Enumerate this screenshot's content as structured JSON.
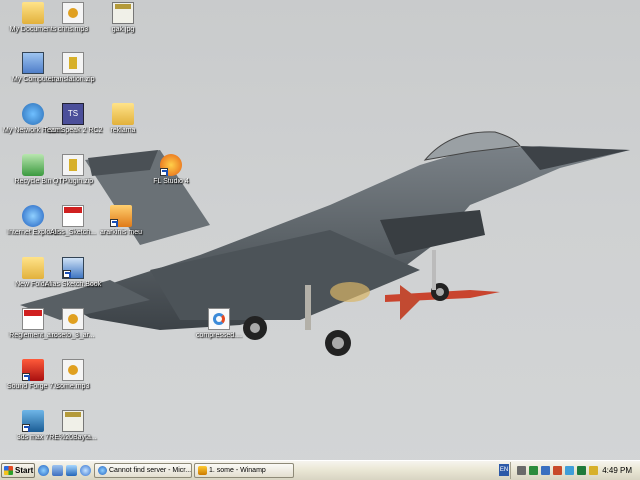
{
  "desktop": {
    "icons": [
      {
        "label": "My Documents",
        "type": "folder-docs-icon"
      },
      {
        "label": "chris.mp3",
        "type": "mp3-file-icon"
      },
      {
        "label": "gak.jpg",
        "type": "jpg-file-icon"
      },
      {
        "label": "My Computer",
        "type": "computer-icon"
      },
      {
        "label": "translation.zip",
        "type": "zip-file-icon"
      },
      {
        "label": "My Network Places",
        "type": "network-icon"
      },
      {
        "label": "TeamSpeak 2 RC2",
        "type": "teamspeak-icon"
      },
      {
        "label": "reklama",
        "type": "folder-icon"
      },
      {
        "label": "Recycle Bin",
        "type": "recycle-bin-icon"
      },
      {
        "label": "QTPlugin.zip",
        "type": "zip-file-icon"
      },
      {
        "label": "FL Studio 4",
        "type": "flstudio-icon"
      },
      {
        "label": "Internet Explorer",
        "type": "ie-icon"
      },
      {
        "label": "Aliss_Sketch...",
        "type": "pdf-file-icon"
      },
      {
        "label": "ararkinis meu",
        "type": "app-shortcut-icon"
      },
      {
        "label": "New Folder",
        "type": "folder-icon"
      },
      {
        "label": "Alias Sketch.Book",
        "type": "sketchbook-icon"
      },
      {
        "label": "Reglement_a...",
        "type": "pdf-file-icon"
      },
      {
        "label": "roseto_3_ar...",
        "type": "mp3-file-icon"
      },
      {
        "label": "compressed....",
        "type": "compressed-file-icon"
      },
      {
        "label": "Sound Forge 7.0",
        "type": "soundforge-icon"
      },
      {
        "label": "some.mp3",
        "type": "mp3-file-icon"
      },
      {
        "label": "3ds max 7",
        "type": "3dsmax-icon"
      },
      {
        "label": "RE%20Bayta...",
        "type": "jpg-file-icon"
      }
    ]
  },
  "taskbar": {
    "start_label": "Start",
    "quick_launch": [
      "ie-quicklaunch-icon",
      "desktop-quicklaunch-icon",
      "media-quicklaunch-icon",
      "ie2-quicklaunch-icon"
    ],
    "tasks": [
      {
        "label": "Cannot find server - Micr...",
        "icon": "ie-task-icon"
      },
      {
        "label": "1. some - Winamp",
        "icon": "winamp-task-icon"
      }
    ],
    "tray": {
      "lang": "EN",
      "time": "4:49 PM"
    }
  },
  "colors": {
    "taskbar": "#ece9d8",
    "sky": "#cfd1d2",
    "jet": "#5f666b"
  }
}
